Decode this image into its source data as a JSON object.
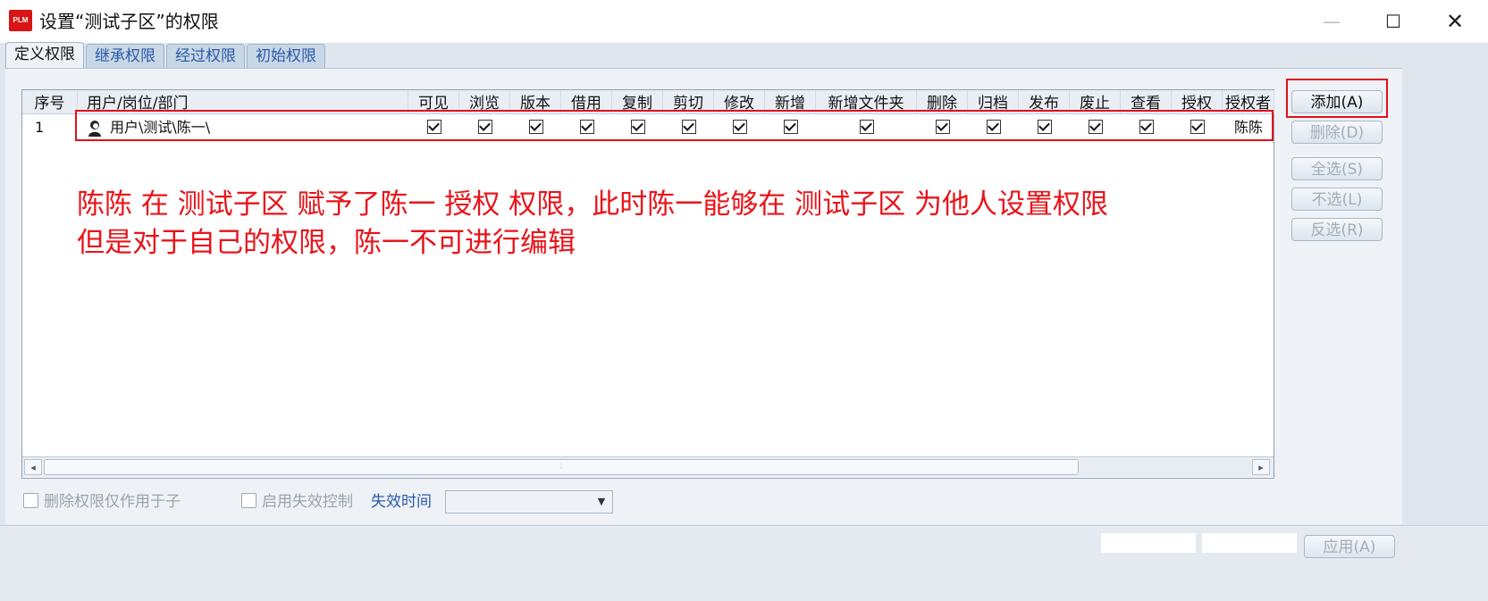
{
  "window": {
    "logo_text": "PLM",
    "title": "设置“测试子区”的权限",
    "min_glyph": "—",
    "max_glyph": "☐",
    "close_glyph": "✕"
  },
  "tabs": [
    {
      "label": "定义权限",
      "active": true
    },
    {
      "label": "继承权限",
      "active": false
    },
    {
      "label": "经过权限",
      "active": false
    },
    {
      "label": "初始权限",
      "active": false
    }
  ],
  "table": {
    "columns": [
      "序号",
      "用户/岗位/部门",
      "可见",
      "浏览",
      "版本",
      "借用",
      "复制",
      "剪切",
      "修改",
      "新增",
      "新增文件夹",
      "删除",
      "归档",
      "发布",
      "废止",
      "查看",
      "授权",
      "授权者"
    ],
    "rows": [
      {
        "index": "1",
        "subject": "用户\\测试\\陈一\\",
        "checked": [
          true,
          true,
          true,
          true,
          true,
          true,
          true,
          true,
          true,
          true,
          true,
          true,
          true,
          true,
          true
        ],
        "grantor": "陈陈"
      }
    ]
  },
  "annotation": {
    "line1": "陈陈 在 测试子区 赋予了陈一 授权 权限，此时陈一能够在 测试子区 为他人设置权限",
    "line2": "但是对于自己的权限，陈一不可进行编辑"
  },
  "scrollbar": {
    "left": "◂",
    "right": "▸",
    "grip": "⦙"
  },
  "side_buttons": {
    "add": "添加(A)",
    "delete": "删除(D)",
    "select_all": "全选(S)",
    "select_none": "不选(L)",
    "invert": "反选(R)"
  },
  "options": {
    "delete_child_only": "删除权限仅作用于子",
    "enable_expiry": "启用失效控制",
    "expiry_time_label": "失效时间",
    "expiry_arrow": "▼"
  },
  "footer": {
    "apply": "应用(A)"
  },
  "colors": {
    "annotation": "#e8141a",
    "highlight_box": "#e0101a",
    "tab_text": "#2a5aa8"
  }
}
